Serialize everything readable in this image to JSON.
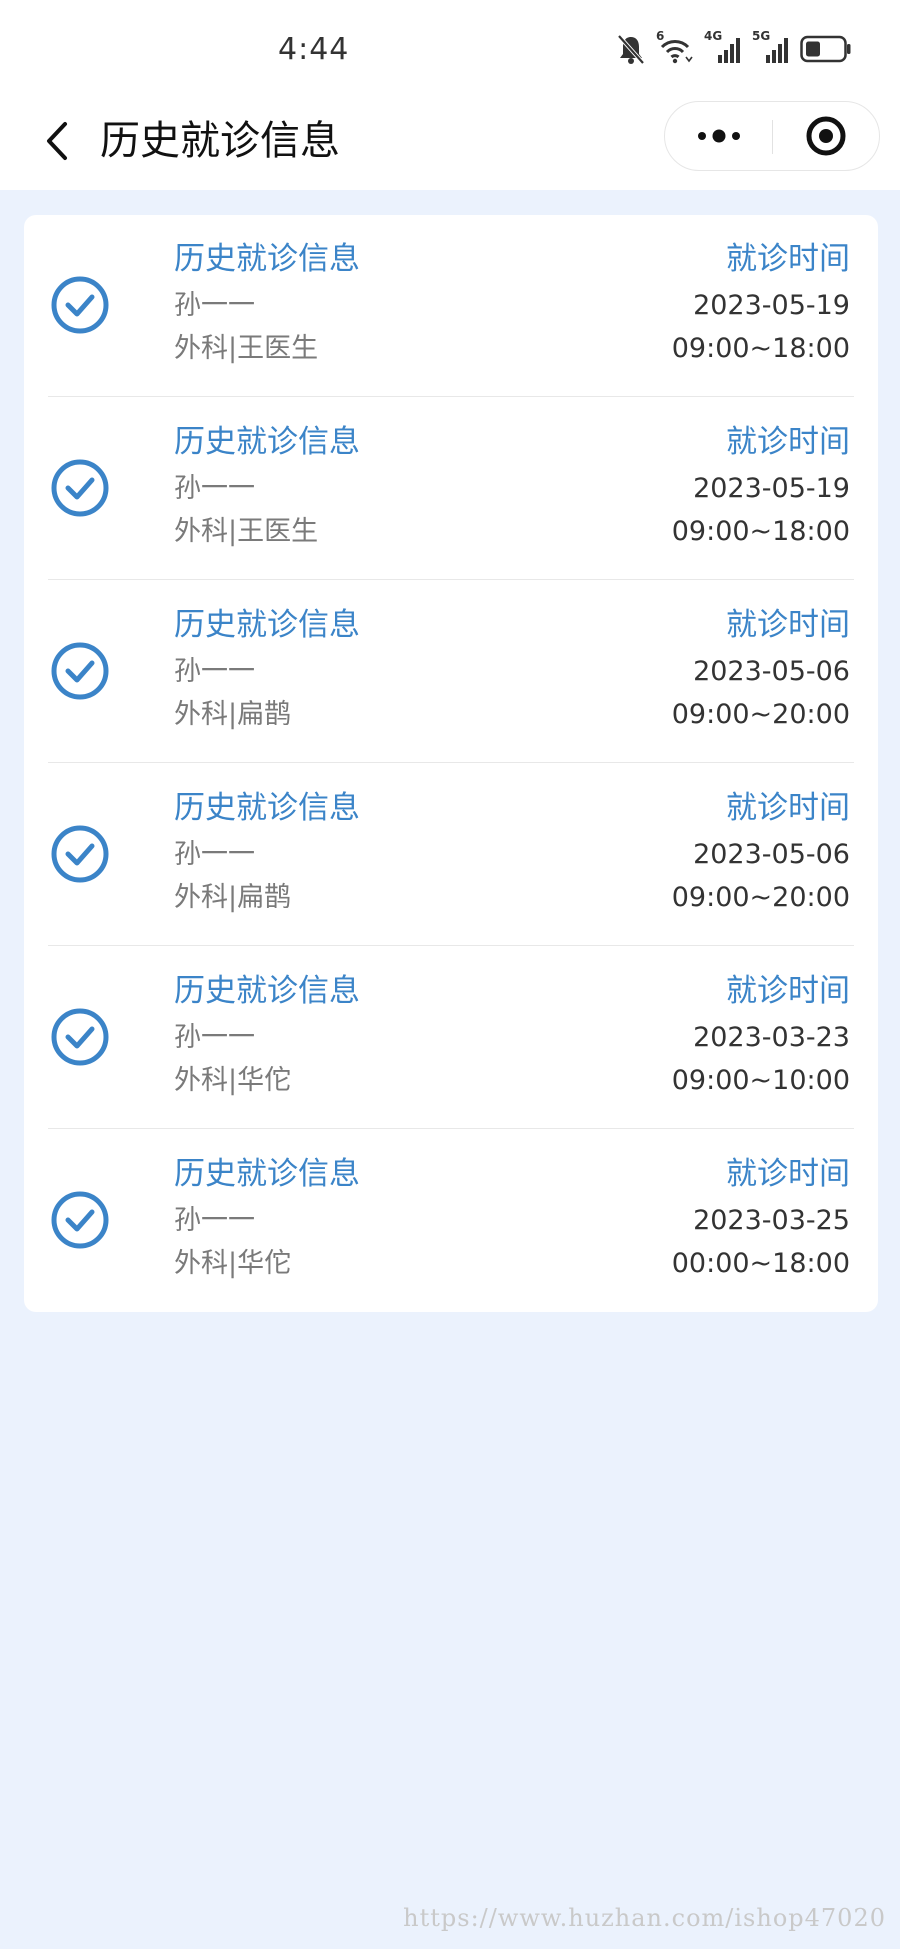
{
  "status_bar": {
    "time": "4:44",
    "icons": [
      "mute-bell-icon",
      "wifi-icon",
      "signal-4g-icon",
      "signal-5g-icon",
      "battery-icon"
    ],
    "labels": {
      "wifi": "6",
      "network1": "4G",
      "network2": "5G"
    }
  },
  "nav": {
    "title": "历史就诊信息",
    "back_icon": "chevron-left-icon",
    "more_icon": "more-dots-icon",
    "close_icon": "target-close-icon"
  },
  "colors": {
    "accent": "#3b84c8",
    "background": "#ebf2fd",
    "card": "#ffffff",
    "secondary_text": "#7a7a7a"
  },
  "records": [
    {
      "title": "历史就诊信息",
      "patient": "孙一一",
      "doctor": "外科|王医生",
      "time_label": "就诊时间",
      "date": "2023-05-19",
      "hours": "09:00~18:00"
    },
    {
      "title": "历史就诊信息",
      "patient": "孙一一",
      "doctor": "外科|王医生",
      "time_label": "就诊时间",
      "date": "2023-05-19",
      "hours": "09:00~18:00"
    },
    {
      "title": "历史就诊信息",
      "patient": "孙一一",
      "doctor": "外科|扁鹊",
      "time_label": "就诊时间",
      "date": "2023-05-06",
      "hours": "09:00~20:00"
    },
    {
      "title": "历史就诊信息",
      "patient": "孙一一",
      "doctor": "外科|扁鹊",
      "time_label": "就诊时间",
      "date": "2023-05-06",
      "hours": "09:00~20:00"
    },
    {
      "title": "历史就诊信息",
      "patient": "孙一一",
      "doctor": "外科|华佗",
      "time_label": "就诊时间",
      "date": "2023-03-23",
      "hours": "09:00~10:00"
    },
    {
      "title": "历史就诊信息",
      "patient": "孙一一",
      "doctor": "外科|华佗",
      "time_label": "就诊时间",
      "date": "2023-03-25",
      "hours": "00:00~18:00"
    }
  ],
  "watermark": "https://www.huzhan.com/ishop47020"
}
